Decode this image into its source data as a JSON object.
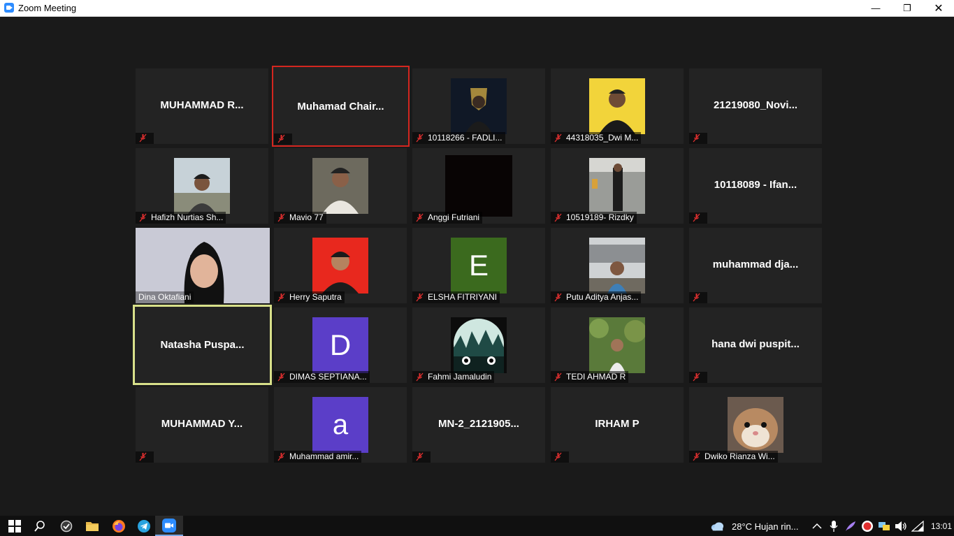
{
  "window": {
    "title": "Zoom Meeting"
  },
  "participants": [
    {
      "name": "MUHAMMAD R...",
      "label": ""
    },
    {
      "name": "Muhamad  Chair...",
      "label": ""
    },
    {
      "name": "",
      "label": "10118266 - FADLI..."
    },
    {
      "name": "",
      "label": "44318035_Dwi M..."
    },
    {
      "name": "21219080_Novi...",
      "label": ""
    },
    {
      "name": "",
      "label": "Hafizh Nurtias Sh..."
    },
    {
      "name": "",
      "label": "Mavio 77"
    },
    {
      "name": "",
      "label": "Anggi Futriani"
    },
    {
      "name": "",
      "label": "10519189- Rizdky"
    },
    {
      "name": "10118089 - Ifan...",
      "label": ""
    },
    {
      "name": "",
      "label": "Dina Oktafiani"
    },
    {
      "name": "",
      "label": "Herry Saputra"
    },
    {
      "name": "",
      "label": "ELSHA FITRIYANI",
      "letter": "E"
    },
    {
      "name": "",
      "label": "Putu Aditya Anjas..."
    },
    {
      "name": "muhammad  dja...",
      "label": ""
    },
    {
      "name": "Natasha  Puspa...",
      "label": ""
    },
    {
      "name": "",
      "label": "DIMAS SEPTIANA...",
      "letter": "D"
    },
    {
      "name": "",
      "label": "Fahmi Jamaludin"
    },
    {
      "name": "",
      "label": "TEDI AHMAD R"
    },
    {
      "name": "hana  dwi  puspit...",
      "label": ""
    },
    {
      "name": "MUHAMMAD  Y...",
      "label": ""
    },
    {
      "name": "",
      "label": "Muhammad amir...",
      "letter": "a"
    },
    {
      "name": "MN-2_2121905...",
      "label": ""
    },
    {
      "name": "IRHAM P",
      "label": ""
    },
    {
      "name": "",
      "label": "Dwiko Rianza Wi..."
    }
  ],
  "taskbar": {
    "weather": "28°C  Hujan rin...",
    "clock": "13:01",
    "apps": [
      "start-icon",
      "search-icon",
      "task-icon",
      "file-explorer-icon",
      "firefox-icon",
      "telegram-icon",
      "zoom-icon"
    ]
  },
  "colors": {
    "accent": "#2d8cff",
    "active_border": "#d4261f",
    "speaking_border": "#d8e08a",
    "mute_red": "#e02f2f"
  }
}
